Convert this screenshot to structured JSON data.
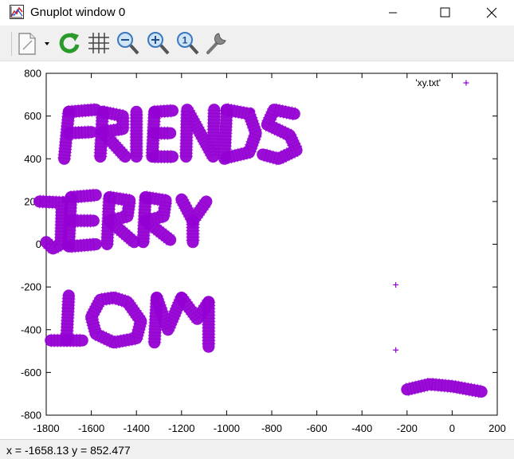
{
  "window": {
    "title": "Gnuplot window 0",
    "icon": "gnuplot-app-icon"
  },
  "toolbar": {
    "buttons": [
      {
        "name": "copy-print-dropdown-button",
        "icon": "page-icon"
      },
      {
        "name": "replot-button",
        "icon": "refresh-icon"
      },
      {
        "name": "toggle-grid-button",
        "icon": "grid-icon"
      },
      {
        "name": "zoom-previous-button",
        "icon": "zoom-out-icon"
      },
      {
        "name": "zoom-next-button",
        "icon": "zoom-in-icon"
      },
      {
        "name": "unzoom-button",
        "icon": "zoom-reset-icon"
      },
      {
        "name": "options-button",
        "icon": "wrench-icon"
      }
    ]
  },
  "chart_data": {
    "type": "scatter",
    "title": "",
    "xlabel": "",
    "ylabel": "",
    "xlim": [
      -1800,
      200
    ],
    "ylim": [
      -800,
      800
    ],
    "xticks": [
      -1800,
      -1600,
      -1400,
      -1200,
      -1000,
      -800,
      -600,
      -400,
      -200,
      0,
      200
    ],
    "yticks": [
      -800,
      -600,
      -400,
      -200,
      0,
      200,
      400,
      600,
      800
    ],
    "xtick_labels": [
      "-1800",
      "-1600",
      "-1400",
      "-1200",
      "-1000",
      "-800",
      "-600",
      "-400",
      "-200",
      "0",
      "200"
    ],
    "ytick_labels": [
      "-800",
      "-600",
      "-400",
      "-200",
      "0",
      "200",
      "400",
      "600",
      "800"
    ],
    "grid": false,
    "legend_position": "top-right",
    "series": [
      {
        "name": "'xy.txt'",
        "color": "#9400d3",
        "marker": "+",
        "isolated_points": [
          [
            -250,
            -190
          ],
          [
            -250,
            -495
          ]
        ],
        "strokes": [
          {
            "group": "FRIENDS",
            "points": [
              [
                -1720,
                400
              ],
              [
                -1700,
                620
              ]
            ]
          },
          {
            "group": "FRIENDS",
            "points": [
              [
                -1700,
                620
              ],
              [
                -1580,
                630
              ]
            ]
          },
          {
            "group": "FRIENDS",
            "points": [
              [
                -1700,
                520
              ],
              [
                -1600,
                525
              ]
            ]
          },
          {
            "group": "FRIENDS",
            "points": [
              [
                -1560,
                410
              ],
              [
                -1550,
                620
              ]
            ]
          },
          {
            "group": "FRIENDS",
            "points": [
              [
                -1550,
                620
              ],
              [
                -1460,
                600
              ],
              [
                -1460,
                540
              ],
              [
                -1550,
                525
              ],
              [
                -1450,
                410
              ]
            ]
          },
          {
            "group": "FRIENDS",
            "points": [
              [
                -1400,
                410
              ],
              [
                -1400,
                620
              ]
            ]
          },
          {
            "group": "FRIENDS",
            "points": [
              [
                -1330,
                410
              ],
              [
                -1320,
                620
              ]
            ]
          },
          {
            "group": "FRIENDS",
            "points": [
              [
                -1320,
                620
              ],
              [
                -1240,
                625
              ]
            ]
          },
          {
            "group": "FRIENDS",
            "points": [
              [
                -1320,
                520
              ],
              [
                -1250,
                520
              ]
            ]
          },
          {
            "group": "FRIENDS",
            "points": [
              [
                -1320,
                410
              ],
              [
                -1240,
                410
              ]
            ]
          },
          {
            "group": "FRIENDS",
            "points": [
              [
                -1180,
                410
              ],
              [
                -1175,
                630
              ],
              [
                -1060,
                410
              ],
              [
                -1055,
                630
              ]
            ]
          },
          {
            "group": "FRIENDS",
            "points": [
              [
                -1010,
                400
              ],
              [
                -1000,
                630
              ]
            ]
          },
          {
            "group": "FRIENDS",
            "points": [
              [
                -1000,
                630
              ],
              [
                -900,
                610
              ],
              [
                -870,
                520
              ],
              [
                -900,
                430
              ],
              [
                -1000,
                405
              ]
            ]
          },
          {
            "group": "FRIENDS",
            "points": [
              [
                -700,
                610
              ],
              [
                -790,
                630
              ],
              [
                -820,
                560
              ],
              [
                -720,
                510
              ],
              [
                -690,
                440
              ],
              [
                -770,
                400
              ],
              [
                -840,
                420
              ]
            ]
          },
          {
            "group": "JERRY",
            "points": [
              [
                -1830,
                200
              ],
              [
                -1730,
                195
              ],
              [
                -1735,
                0
              ],
              [
                -1770,
                -20
              ],
              [
                -1800,
                10
              ]
            ]
          },
          {
            "group": "JERRY",
            "points": [
              [
                -1700,
                -10
              ],
              [
                -1690,
                220
              ]
            ]
          },
          {
            "group": "JERRY",
            "points": [
              [
                -1690,
                220
              ],
              [
                -1580,
                230
              ]
            ]
          },
          {
            "group": "JERRY",
            "points": [
              [
                -1690,
                110
              ],
              [
                -1590,
                110
              ]
            ]
          },
          {
            "group": "JERRY",
            "points": [
              [
                -1690,
                -10
              ],
              [
                -1580,
                0
              ]
            ]
          },
          {
            "group": "JERRY",
            "points": [
              [
                -1530,
                0
              ],
              [
                -1520,
                220
              ]
            ]
          },
          {
            "group": "JERRY",
            "points": [
              [
                -1520,
                220
              ],
              [
                -1430,
                205
              ],
              [
                -1440,
                130
              ],
              [
                -1520,
                110
              ],
              [
                -1410,
                10
              ]
            ]
          },
          {
            "group": "JERRY",
            "points": [
              [
                -1370,
                10
              ],
              [
                -1360,
                220
              ]
            ]
          },
          {
            "group": "JERRY",
            "points": [
              [
                -1360,
                220
              ],
              [
                -1270,
                205
              ],
              [
                -1280,
                130
              ],
              [
                -1360,
                110
              ],
              [
                -1250,
                20
              ]
            ]
          },
          {
            "group": "JERRY",
            "points": [
              [
                -1200,
                210
              ],
              [
                -1150,
                110
              ],
              [
                -1090,
                200
              ]
            ]
          },
          {
            "group": "JERRY",
            "points": [
              [
                -1150,
                110
              ],
              [
                -1150,
                10
              ]
            ]
          },
          {
            "group": "TOM",
            "points": [
              [
                -1780,
                -450
              ],
              [
                -1640,
                -450
              ]
            ]
          },
          {
            "group": "TOM",
            "points": [
              [
                -1710,
                -450
              ],
              [
                -1700,
                -240
              ]
            ]
          },
          {
            "group": "TOM",
            "points": [
              [
                -1500,
                -250
              ],
              [
                -1440,
                -270
              ],
              [
                -1380,
                -360
              ],
              [
                -1400,
                -440
              ],
              [
                -1500,
                -460
              ],
              [
                -1580,
                -420
              ],
              [
                -1600,
                -340
              ],
              [
                -1560,
                -260
              ],
              [
                -1500,
                -250
              ]
            ]
          },
          {
            "group": "TOM",
            "points": [
              [
                -1320,
                -460
              ],
              [
                -1310,
                -250
              ]
            ]
          },
          {
            "group": "TOM",
            "points": [
              [
                -1310,
                -250
              ],
              [
                -1260,
                -400
              ],
              [
                -1200,
                -250
              ]
            ]
          },
          {
            "group": "TOM",
            "points": [
              [
                -1200,
                -250
              ],
              [
                -1130,
                -350
              ],
              [
                -1080,
                -270
              ]
            ]
          },
          {
            "group": "TOM",
            "points": [
              [
                -1080,
                -270
              ],
              [
                -1080,
                -480
              ]
            ]
          },
          {
            "group": "DASH",
            "points": [
              [
                -200,
                -680
              ],
              [
                -100,
                -655
              ],
              [
                0,
                -665
              ],
              [
                130,
                -690
              ]
            ]
          }
        ]
      }
    ]
  },
  "status": {
    "coordinates": "x = -1658.13 y = 852.477"
  }
}
